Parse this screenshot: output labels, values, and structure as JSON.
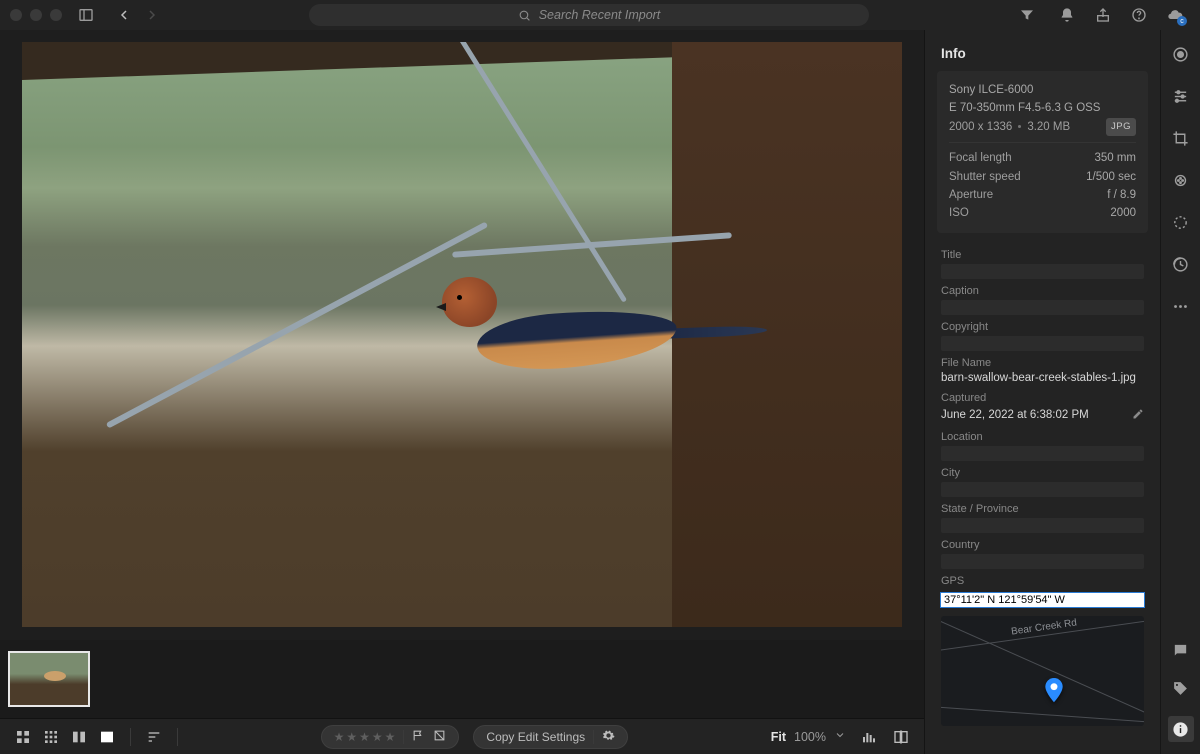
{
  "search": {
    "placeholder": "Search Recent Import"
  },
  "info": {
    "panel_title": "Info",
    "camera": "Sony ILCE-6000",
    "lens": "E 70-350mm F4.5-6.3 G OSS",
    "dimensions": "2000 x 1336",
    "filesize": "3.20 MB",
    "format_badge": "JPG",
    "exif": {
      "focal_length_label": "Focal length",
      "focal_length": "350 mm",
      "shutter_label": "Shutter speed",
      "shutter": "1/500 sec",
      "aperture_label": "Aperture",
      "aperture": "f / 8.9",
      "iso_label": "ISO",
      "iso": "2000"
    },
    "fields": {
      "title_label": "Title",
      "title": "",
      "caption_label": "Caption",
      "caption": "",
      "copyright_label": "Copyright",
      "copyright": "",
      "filename_label": "File Name",
      "filename": "barn-swallow-bear-creek-stables-1.jpg",
      "captured_label": "Captured",
      "captured": "June 22, 2022 at 6:38:02 PM",
      "location_label": "Location",
      "location": "",
      "city_label": "City",
      "city": "",
      "state_label": "State / Province",
      "state": "",
      "country_label": "Country",
      "country": "",
      "gps_label": "GPS",
      "gps": "37°11'2\" N 121°59'54\" W"
    },
    "map": {
      "road_label": "Bear Creek Rd"
    }
  },
  "bottom": {
    "copy_settings": "Copy Edit Settings",
    "fit_label": "Fit",
    "zoom_pct": "100%"
  }
}
